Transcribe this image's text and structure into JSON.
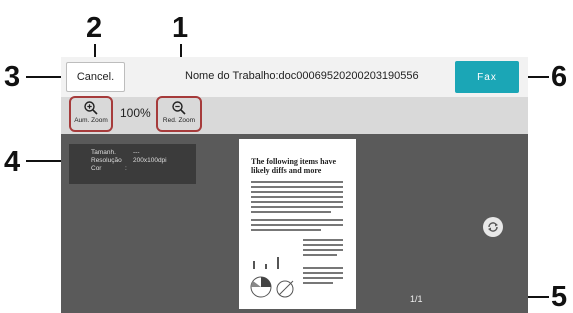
{
  "callouts": {
    "n1": "1",
    "n2": "2",
    "n3": "3",
    "n4": "4",
    "n5": "5",
    "n6": "6"
  },
  "topbar": {
    "cancel_label": "Cancel.",
    "job_title": "Nome do Trabalho:doc00069520200203190556",
    "fax_label": "Fax"
  },
  "toolbar": {
    "zoom_in_label": "Aum. Zoom",
    "zoom_level": "100%",
    "zoom_out_label": "Red. Zoom"
  },
  "info": {
    "size_label": "Tamanh.",
    "size_value": "---",
    "resolution_label": "Resolução",
    "resolution_value": "200x100dpi",
    "color_label": "Cor",
    "color_value": ":"
  },
  "preview": {
    "heading_line1": "The following items have",
    "heading_line2": "likely diffs and more",
    "page_count": "1/1"
  },
  "colors": {
    "accent": "#1ba6b6",
    "highlight": "#a63b3b",
    "viewer_bg": "#5a5a5a"
  }
}
